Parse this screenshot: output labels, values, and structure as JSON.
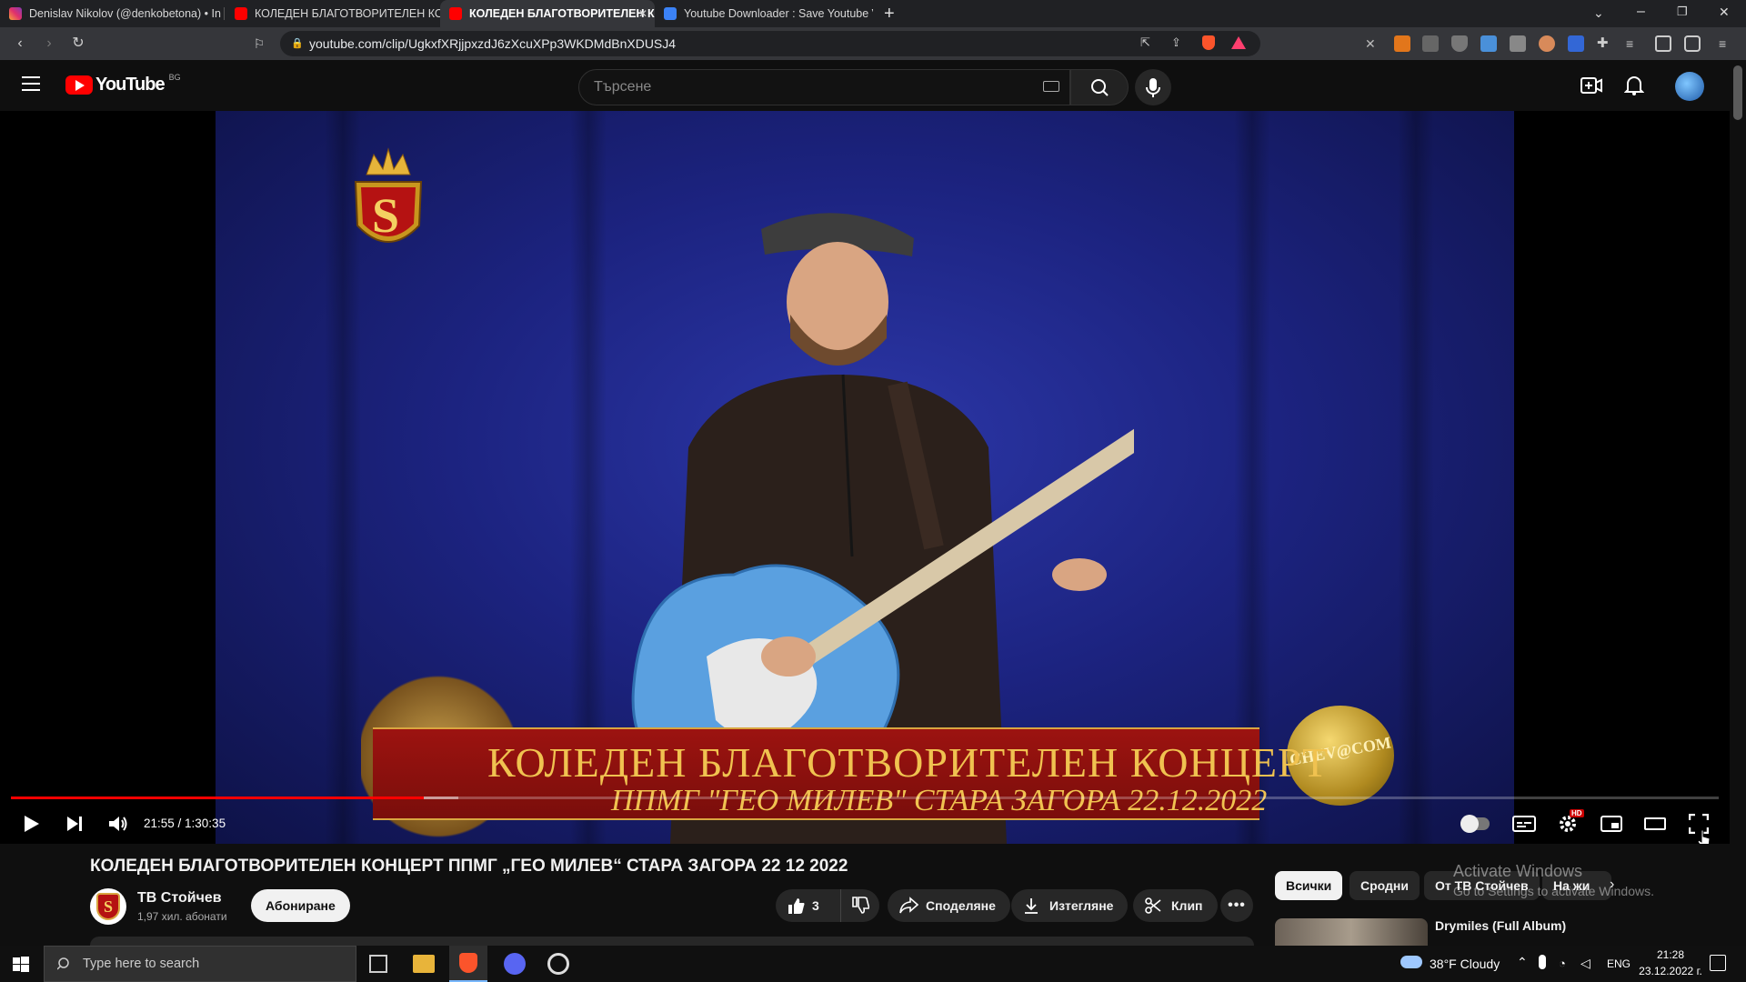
{
  "browser": {
    "tabs": [
      {
        "title": "Denislav Nikolov (@denkobetona) • In",
        "favicon": "instagram-icon",
        "active": false
      },
      {
        "title": "КОЛЕДЕН БЛАГОТВОРИТЕЛЕН КОНЦ",
        "favicon": "youtube-icon",
        "active": false
      },
      {
        "title": "КОЛЕДЕН БЛАГОТВОРИТЕЛЕН К",
        "favicon": "youtube-icon",
        "active": true
      },
      {
        "title": "Youtube Downloader : Save Youtube V",
        "favicon": "downloader-icon",
        "active": false
      }
    ],
    "url": "youtube.com/clip/UgkxfXRjjpxzdJ6zXcuXPp3WKDMdBnXDUSJ4"
  },
  "youtube": {
    "logo_text": "YouTube",
    "region": "BG",
    "search_placeholder": "Търсене"
  },
  "video": {
    "banner_line1": "КОЛЕДЕН БЛАГОТВОРИТЕЛЕН КОНЦЕРТ",
    "banner_line2": "ППМГ \"ГЕО МИЛЕВ\" СТАРА ЗАГОРА  22.12.2022",
    "watermark_left": "S",
    "watermark_right": "CHEV@COM",
    "time_current": "21:55",
    "time_total": "1:30:35",
    "time_display": "21:55 / 1:30:35",
    "progress_fraction": 0.242,
    "buffer_fraction": 0.262,
    "settings_badge": "HD"
  },
  "details": {
    "title": "КОЛЕДЕН БЛАГОТВОРИТЕЛЕН КОНЦЕРТ ППМГ „ГЕО МИЛЕВ“ СТАРА ЗАГОРА 22 12 2022",
    "channel_name": "ТВ Стойчев",
    "subscribers": "1,97 хил. абонати",
    "subscribe_label": "Абониране",
    "likes": "3",
    "share_label": "Споделяне",
    "download_label": "Изтегляне",
    "clip_label": "Клип"
  },
  "recommendations": {
    "chips": [
      "Всички",
      "Сродни",
      "От ТВ Стойчев",
      "На жи"
    ],
    "first_title": "Drymiles (Full Album)"
  },
  "watermark": {
    "line1": "Activate Windows",
    "line2": "Go to Settings to activate Windows."
  },
  "taskbar": {
    "search_placeholder": "Type here to search",
    "weather": "38°F  Cloudy",
    "language": "ENG",
    "time": "21:28",
    "date": "23.12.2022 г."
  },
  "colors": {
    "youtube_red": "#ff0000",
    "banner_red": "#8c110e",
    "banner_gold": "#f0c250",
    "stage_blue": "#1c2380"
  }
}
